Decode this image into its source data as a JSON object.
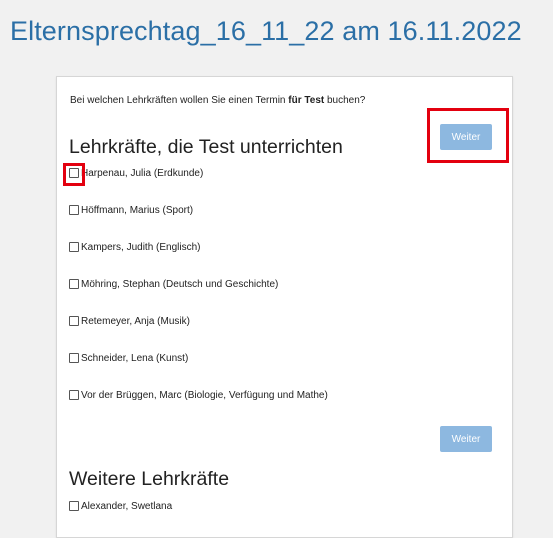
{
  "page": {
    "title": "Elternsprechtag_16_11_22 am 16.11.2022"
  },
  "form": {
    "intro_prefix": "Bei welchen Lehrkräften wollen Sie einen Termin ",
    "intro_bold": "für Test",
    "intro_suffix": " buchen?",
    "section_title": "Lehrkräfte, die Test unterrichten",
    "next_button_label": "Weiter",
    "next_button_bottom_label": "Weiter",
    "teachers": [
      {
        "label": "Harpenau, Julia (Erdkunde)",
        "checked": false
      },
      {
        "label": "Höffmann, Marius (Sport)",
        "checked": false
      },
      {
        "label": "Kampers, Judith (Englisch)",
        "checked": false
      },
      {
        "label": "Möhring, Stephan (Deutsch und Geschichte)",
        "checked": false
      },
      {
        "label": "Retemeyer, Anja (Musik)",
        "checked": false
      },
      {
        "label": "Schneider, Lena (Kunst)",
        "checked": false
      },
      {
        "label": "Vor der Brüggen, Marc (Biologie, Verfügung und Mathe)",
        "checked": false
      }
    ],
    "further_section_title": "Weitere Lehrkräfte",
    "further_teachers": [
      {
        "label": "Alexander, Swetlana",
        "checked": false
      }
    ]
  },
  "colors": {
    "title": "#2b6fa6",
    "button": "#8db8e0",
    "highlight": "#e3000f"
  }
}
